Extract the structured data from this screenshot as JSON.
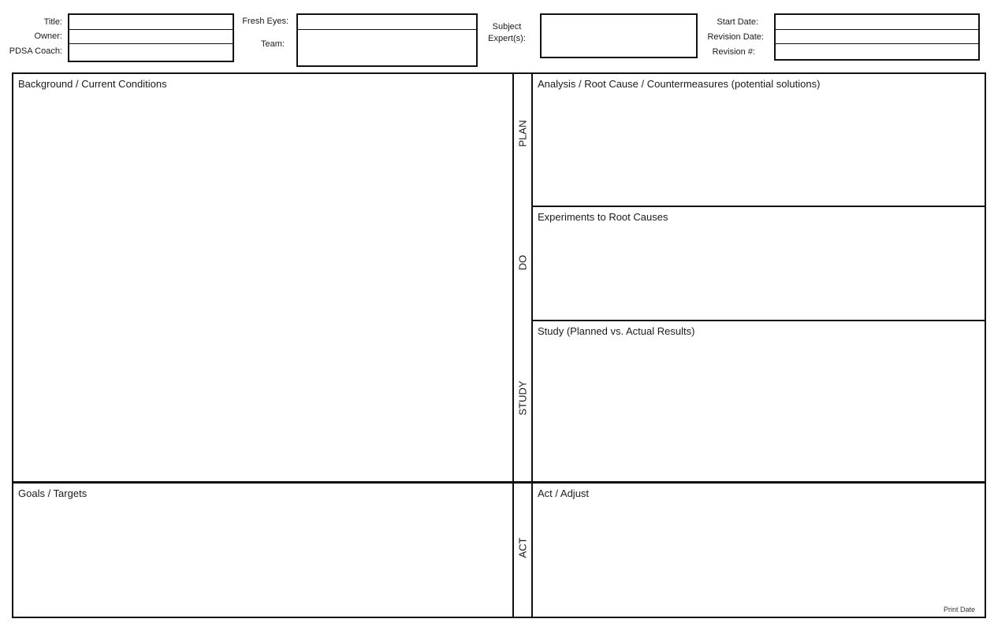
{
  "header": {
    "left_fields": [
      {
        "label": "Title:",
        "value": ""
      },
      {
        "label": "Owner:",
        "value": ""
      },
      {
        "label": "PDSA Coach:",
        "value": ""
      }
    ],
    "middle_fields": [
      {
        "label": "Fresh Eyes:",
        "value": ""
      },
      {
        "label": "Team:",
        "value": ""
      }
    ],
    "subject_expert": {
      "label_line1": "Subject",
      "label_line2": "Expert(s):",
      "value": ""
    },
    "right_fields": [
      {
        "label": "Start Date:",
        "value": ""
      },
      {
        "label": "Revision Date:",
        "value": ""
      },
      {
        "label": "Revision #:",
        "value": ""
      }
    ]
  },
  "sections": {
    "background": {
      "title": "Background / Current Conditions",
      "content": ""
    },
    "goals": {
      "title": "Goals / Targets",
      "content": ""
    },
    "plan": {
      "phase": "PLAN",
      "title": "Analysis / Root Cause / Countermeasures (potential solutions)",
      "content": ""
    },
    "do": {
      "phase": "DO",
      "title": "Experiments to Root Causes",
      "content": ""
    },
    "study": {
      "phase": "STUDY",
      "title": "Study (Planned vs. Actual Results)",
      "content": ""
    },
    "act": {
      "phase": "ACT",
      "title": "Act / Adjust",
      "content": ""
    }
  },
  "footer": {
    "print_date_label": "Print Date"
  }
}
